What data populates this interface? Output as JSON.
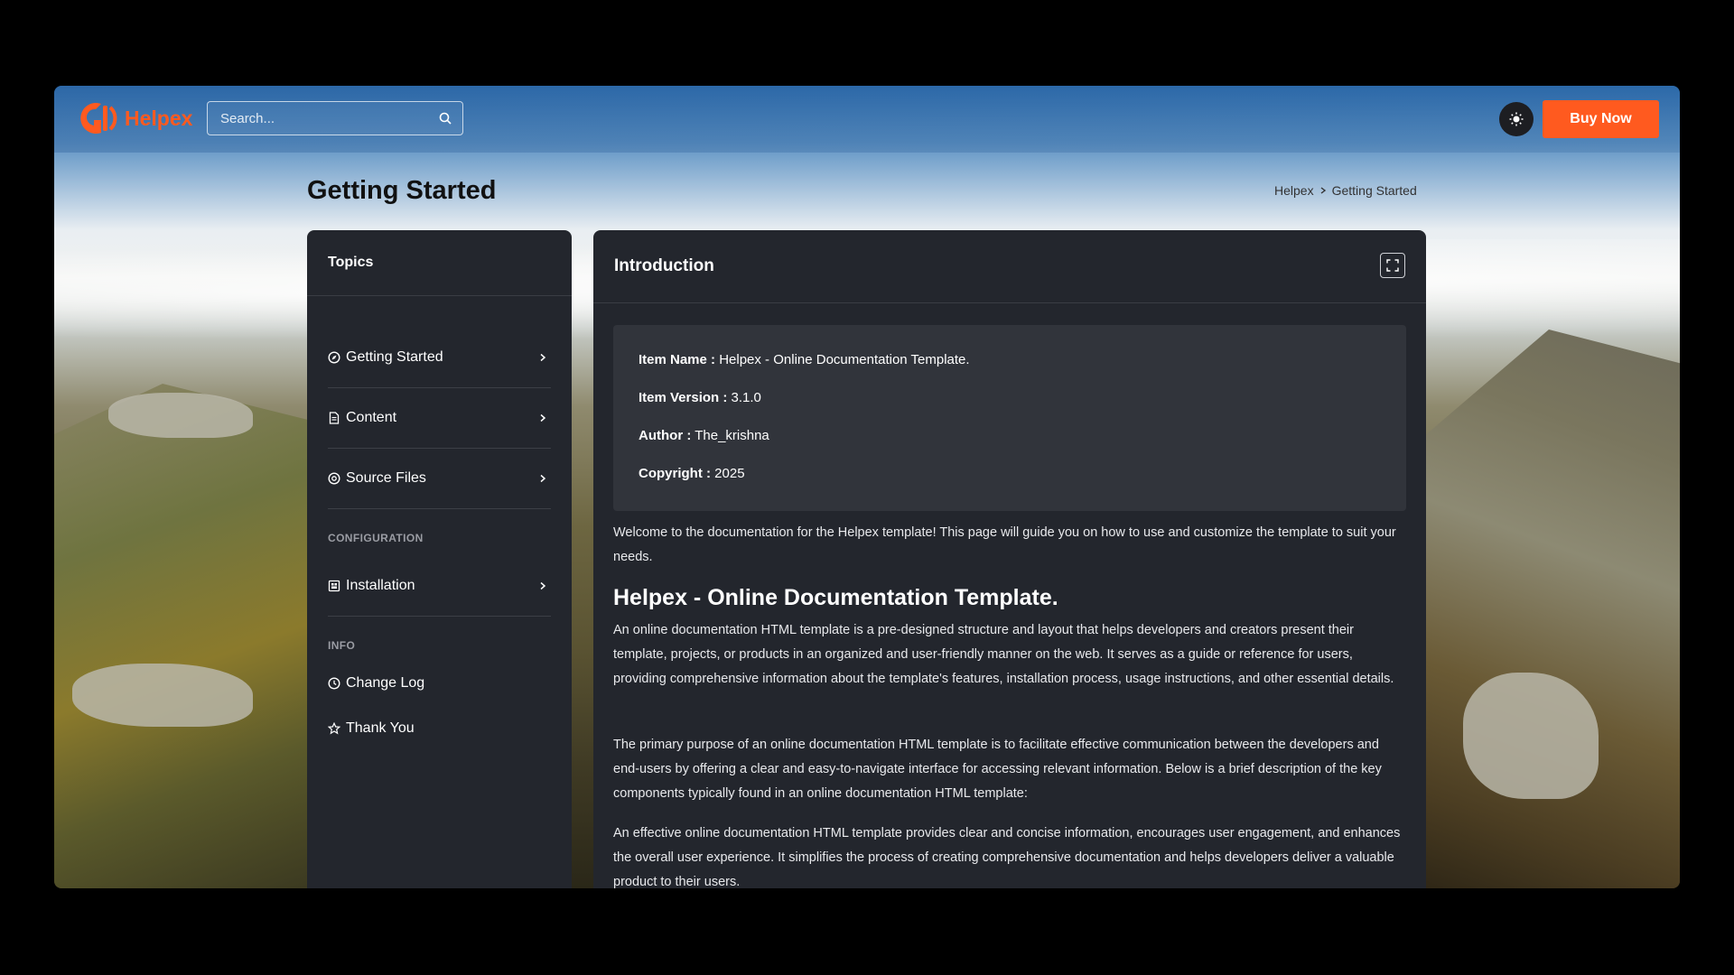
{
  "header": {
    "brand": "Helpex",
    "search_placeholder": "Search...",
    "theme_toggle": "sun-icon",
    "buy_button": "Buy Now"
  },
  "page": {
    "title": "Getting Started",
    "breadcrumb": [
      "Helpex",
      "Getting Started"
    ]
  },
  "sidebar": {
    "title": "Topics",
    "items": [
      {
        "label": "Getting Started",
        "icon": "compass-icon"
      },
      {
        "label": "Content",
        "icon": "document-icon"
      },
      {
        "label": "Source Files",
        "icon": "source-icon"
      }
    ],
    "section_configuration": "CONFIGURATION",
    "config_items": [
      {
        "label": "Installation",
        "icon": "install-icon"
      }
    ],
    "section_info": "INFO",
    "info_items": [
      {
        "label": "Change Log",
        "icon": "clock-icon"
      },
      {
        "label": "Thank You",
        "icon": "star-icon"
      }
    ]
  },
  "content": {
    "title": "Introduction",
    "info": [
      {
        "key": "Item Name :",
        "value": " Helpex - Online Documentation Template."
      },
      {
        "key": "Item Version :",
        "value": " 3.1.0"
      },
      {
        "key": "Author :",
        "value": " The_krishna"
      },
      {
        "key": "Copyright :",
        "value": " 2025"
      }
    ],
    "welcome": "Welcome to the documentation for the Helpex template! This page will guide you on how to use and customize the template to suit your needs.",
    "heading": "Helpex - Online Documentation Template.",
    "paragraphs": [
      "An online documentation HTML template is a pre-designed structure and layout that helps developers and creators present their template, projects, or products in an organized and user-friendly manner on the web. It serves as a guide or reference for users, providing comprehensive information about the template's features, installation process, usage instructions, and other essential details.",
      "The primary purpose of an online documentation HTML template is to facilitate effective communication between the developers and end-users by offering a clear and easy-to-navigate interface for accessing relevant information. Below is a brief description of the key components typically found in an online documentation HTML template:",
      "An effective online documentation HTML template provides clear and concise information, encourages user engagement, and enhances the overall user experience. It simplifies the process of creating comprehensive documentation and helps developers deliver a valuable product to their users."
    ]
  },
  "colors": {
    "accent": "#ff5a1f",
    "panel": "#23262d",
    "info_box": "#31343b"
  }
}
